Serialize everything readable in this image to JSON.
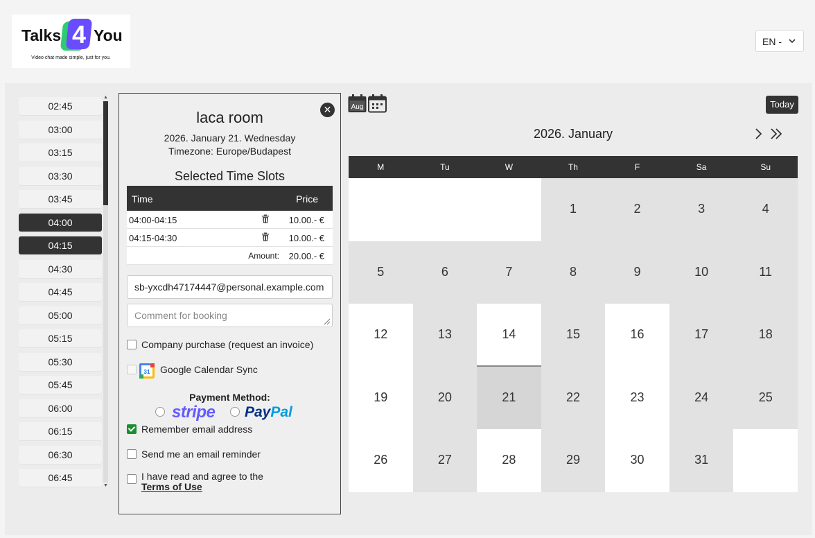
{
  "header": {
    "logo": {
      "left": "Talks",
      "digit": "4",
      "right": "You",
      "tagline": "Video chat made simple, just for you."
    },
    "language": {
      "value": "EN -"
    }
  },
  "time_slots": [
    {
      "label": "02:45",
      "selected": false
    },
    {
      "label": "03:00",
      "selected": false
    },
    {
      "label": "03:15",
      "selected": false
    },
    {
      "label": "03:30",
      "selected": false
    },
    {
      "label": "03:45",
      "selected": false
    },
    {
      "label": "04:00",
      "selected": true
    },
    {
      "label": "04:15",
      "selected": true
    },
    {
      "label": "04:30",
      "selected": false
    },
    {
      "label": "04:45",
      "selected": false
    },
    {
      "label": "05:00",
      "selected": false
    },
    {
      "label": "05:15",
      "selected": false
    },
    {
      "label": "05:30",
      "selected": false
    },
    {
      "label": "05:45",
      "selected": false
    },
    {
      "label": "06:00",
      "selected": false
    },
    {
      "label": "06:15",
      "selected": false
    },
    {
      "label": "06:30",
      "selected": false
    },
    {
      "label": "06:45",
      "selected": false
    }
  ],
  "booking": {
    "room_name": "laca room",
    "date": "2026. January 21. Wednesday",
    "timezone": "Timezone: Europe/Budapest",
    "selected_title": "Selected Time Slots",
    "table": {
      "headers": {
        "time": "Time",
        "price": "Price"
      },
      "rows": [
        {
          "time": "04:00-04:15",
          "price": "10.00.- €"
        },
        {
          "time": "04:15-04:30",
          "price": "10.00.- €"
        }
      ],
      "amount_label": "Amount:",
      "amount_value": "20.00.- €"
    },
    "email_value": "sb-yxcdh47174447@personal.example.com",
    "comment_placeholder": "Comment for booking",
    "company_purchase_label": "Company purchase (request an invoice)",
    "gcal_label": "Google Calendar Sync",
    "payment_title": "Payment Method:",
    "stripe_label": "stripe",
    "paypal_1": "Pay",
    "paypal_2": "Pal",
    "remember_label": "Remember email address",
    "reminder_label": "Send me an email reminder",
    "agree_label": "I have read and agree to the",
    "terms_label": "Terms of Use"
  },
  "calendar": {
    "month_badge": "Aug",
    "today_label": "Today",
    "month_title": "2026. January",
    "weekdays": [
      "M",
      "Tu",
      "W",
      "Th",
      "F",
      "Sa",
      "Su"
    ],
    "cells": [
      {
        "day": "",
        "style": "w"
      },
      {
        "day": "",
        "style": "w"
      },
      {
        "day": "",
        "style": "w"
      },
      {
        "day": "1",
        "style": "g"
      },
      {
        "day": "2",
        "style": "g"
      },
      {
        "day": "3",
        "style": "g"
      },
      {
        "day": "4",
        "style": "g"
      },
      {
        "day": "5",
        "style": "g"
      },
      {
        "day": "6",
        "style": "g"
      },
      {
        "day": "7",
        "style": "g"
      },
      {
        "day": "8",
        "style": "g"
      },
      {
        "day": "9",
        "style": "g"
      },
      {
        "day": "10",
        "style": "g"
      },
      {
        "day": "11",
        "style": "g"
      },
      {
        "day": "12",
        "style": "w"
      },
      {
        "day": "13",
        "style": "g"
      },
      {
        "day": "14",
        "style": "w today"
      },
      {
        "day": "15",
        "style": "g"
      },
      {
        "day": "16",
        "style": "w"
      },
      {
        "day": "17",
        "style": "g"
      },
      {
        "day": "18",
        "style": "g"
      },
      {
        "day": "19",
        "style": "w"
      },
      {
        "day": "20",
        "style": "g"
      },
      {
        "day": "21",
        "style": "sel"
      },
      {
        "day": "22",
        "style": "g"
      },
      {
        "day": "23",
        "style": "w"
      },
      {
        "day": "24",
        "style": "g"
      },
      {
        "day": "25",
        "style": "g"
      },
      {
        "day": "26",
        "style": "w"
      },
      {
        "day": "27",
        "style": "g"
      },
      {
        "day": "28",
        "style": "w"
      },
      {
        "day": "29",
        "style": "g"
      },
      {
        "day": "30",
        "style": "w"
      },
      {
        "day": "31",
        "style": "g"
      },
      {
        "day": "",
        "style": "w"
      }
    ]
  }
}
